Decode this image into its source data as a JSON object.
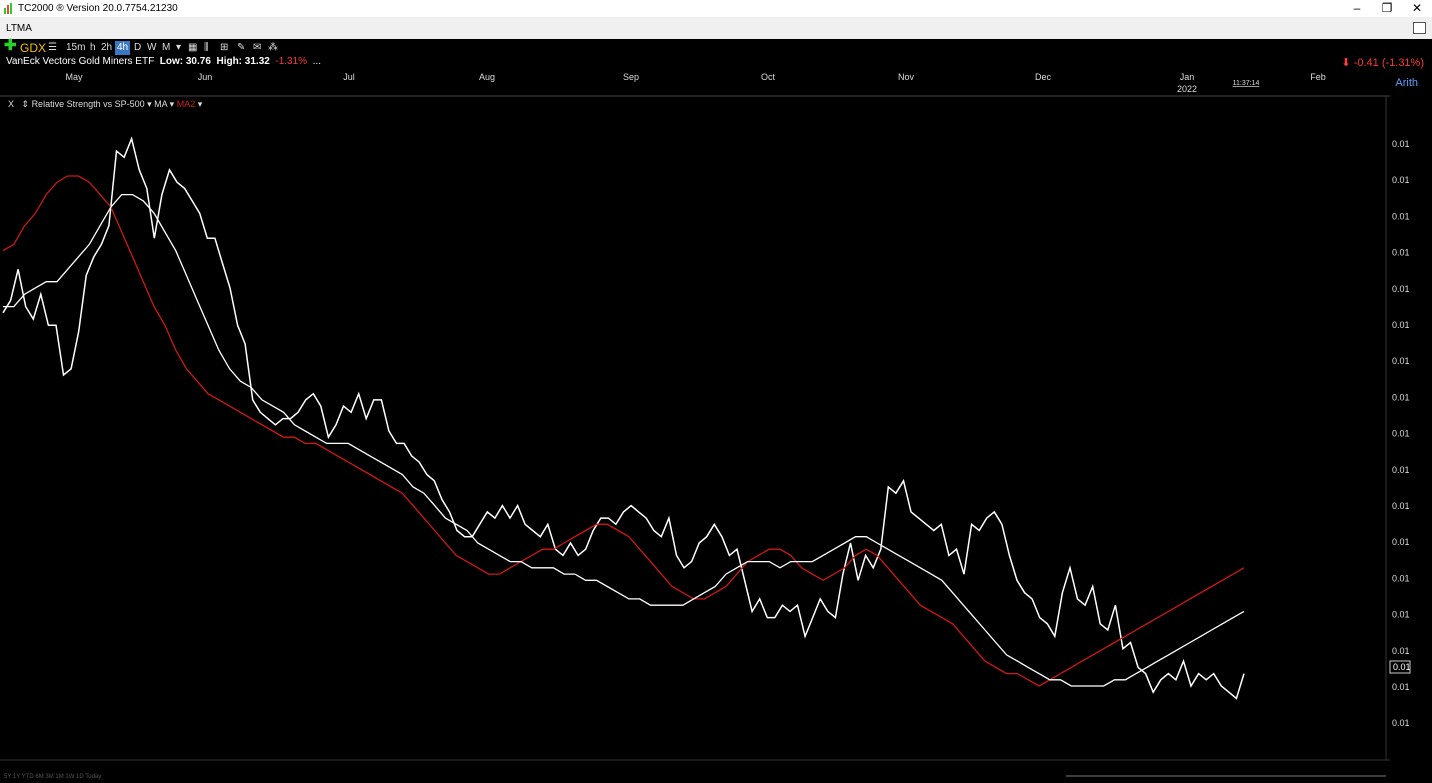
{
  "window": {
    "title": "TC2000 ® Version 20.0.7754.21230",
    "min": "–",
    "restore": "❐",
    "close": "✕"
  },
  "tab": {
    "label": "LTMA"
  },
  "toolbar": {
    "symbol": "GDX",
    "timeframes": [
      "15m",
      "h",
      "2h",
      "4h",
      "D",
      "W",
      "M"
    ],
    "selected_timeframe": "4h"
  },
  "security": {
    "name": "VanEck Vectors Gold Miners ETF",
    "low_label": "Low:",
    "low": "30.76",
    "high_label": "High:",
    "high": "31.32",
    "change": "-1.31%",
    "more": "...",
    "right_change": "-0.41 (-1.31%)"
  },
  "indicator": {
    "label": "Relative Strength vs SP-500",
    "ma": "MA",
    "ma2": "MA2",
    "close": "X"
  },
  "scale_mode": "Arith",
  "clock": "11:37:14",
  "bottom_ranges": "5Y 1Y YTD 6M 3M 1M 1W 1D Today",
  "colors": {
    "rs_line": "#ffffff",
    "ma_slow": "#ffffff",
    "ma_fast": "#d01818",
    "background": "#000000",
    "up": "#2bd12b",
    "down": "#ff3b3b"
  },
  "chart_data": {
    "type": "line",
    "x_labels": [
      "May",
      "Jun",
      "Jul",
      "Aug",
      "Sep",
      "Oct",
      "Nov",
      "Dec",
      "Jan",
      "Feb"
    ],
    "x_sublabel": "2022",
    "y_tick_labels": [
      "0.01",
      "0.01",
      "0.01",
      "0.01",
      "0.01",
      "0.01",
      "0.01",
      "0.01",
      "0.01",
      "0.01",
      "0.01",
      "0.01",
      "0.01",
      "0.01",
      "0.01",
      "0.01",
      "0.01"
    ],
    "last_value_label": "0.01",
    "series": [
      {
        "name": "Relative Strength vs SP-500",
        "color": "#ffffff",
        "values": [
          69,
          71,
          76,
          70,
          68,
          72,
          67,
          67,
          59,
          60,
          66,
          75,
          78,
          80,
          83,
          95,
          94,
          97,
          92,
          89,
          81,
          88,
          92,
          90,
          89,
          87,
          85,
          81,
          81,
          77,
          73,
          67,
          64,
          55,
          53,
          52,
          51,
          52,
          52,
          53,
          55,
          56,
          54,
          49,
          51,
          54,
          53,
          56,
          52,
          55,
          55,
          50,
          48,
          48,
          46,
          45,
          43,
          42,
          39,
          37,
          34,
          33,
          33,
          35,
          37,
          36,
          38,
          36,
          38,
          35,
          34,
          33,
          35,
          31,
          30,
          32,
          30,
          31,
          34,
          36,
          36,
          35,
          37,
          38,
          37,
          36,
          34,
          33,
          36,
          30,
          28,
          29,
          32,
          33,
          35,
          33,
          30,
          31,
          26,
          21,
          23,
          20,
          20,
          22,
          21,
          22,
          17,
          20,
          23,
          21,
          20,
          27,
          32,
          26,
          30,
          28,
          31,
          41,
          40,
          42,
          37,
          36,
          35,
          34,
          35,
          30,
          31,
          27,
          35,
          34,
          36,
          37,
          35,
          30,
          26,
          24,
          23,
          20,
          19,
          17,
          24,
          28,
          23,
          22,
          25,
          19,
          18,
          22,
          15,
          16,
          12,
          11,
          8,
          10,
          11,
          10,
          13,
          9,
          11,
          10,
          11,
          9,
          8,
          7,
          11
        ]
      },
      {
        "name": "MA2",
        "color": "#d01818",
        "values": [
          79,
          80,
          83,
          85,
          88,
          90,
          91,
          91,
          90,
          88,
          86,
          82,
          78,
          74,
          70,
          67,
          63,
          60,
          58,
          56,
          55,
          54,
          53,
          52,
          51,
          50,
          49,
          49,
          48,
          48,
          47,
          46,
          45,
          44,
          43,
          42,
          41,
          40,
          38,
          36,
          34,
          32,
          30,
          29,
          28,
          27,
          27,
          28,
          29,
          30,
          31,
          31,
          32,
          33,
          34,
          35,
          35,
          34,
          33,
          31,
          29,
          27,
          25,
          24,
          23,
          23,
          24,
          25,
          27,
          29,
          30,
          31,
          31,
          30,
          28,
          27,
          26,
          27,
          28,
          30,
          31,
          30,
          28,
          26,
          24,
          22,
          21,
          20,
          19,
          17,
          15,
          13,
          12,
          11,
          11,
          10,
          9,
          10,
          11,
          12,
          13,
          14,
          15,
          16,
          17,
          18,
          19,
          20,
          21,
          22,
          23,
          24,
          25,
          26,
          27,
          28
        ]
      },
      {
        "name": "MA",
        "color": "#ffffff",
        "values": [
          70,
          70,
          72,
          73,
          74,
          74,
          76,
          78,
          80,
          83,
          86,
          88,
          88,
          87,
          85,
          82,
          79,
          75,
          71,
          67,
          63,
          60,
          58,
          57,
          55,
          54,
          53,
          51,
          50,
          49,
          48,
          48,
          48,
          47,
          46,
          45,
          44,
          43,
          41,
          40,
          38,
          36,
          35,
          34,
          32,
          31,
          30,
          29,
          29,
          28,
          28,
          28,
          27,
          27,
          26,
          26,
          25,
          24,
          23,
          23,
          22,
          22,
          22,
          22,
          23,
          24,
          25,
          27,
          28,
          29,
          29,
          29,
          28,
          29,
          29,
          29,
          30,
          31,
          32,
          33,
          33,
          32,
          31,
          30,
          29,
          28,
          27,
          26,
          24,
          22,
          20,
          18,
          16,
          14,
          13,
          12,
          11,
          10,
          10,
          9,
          9,
          9,
          9,
          10,
          10,
          11,
          12,
          13,
          14,
          15,
          16,
          17,
          18,
          19,
          20,
          21
        ]
      }
    ],
    "ylim": [
      0,
      100
    ],
    "grid": false,
    "legend": "top-left"
  }
}
